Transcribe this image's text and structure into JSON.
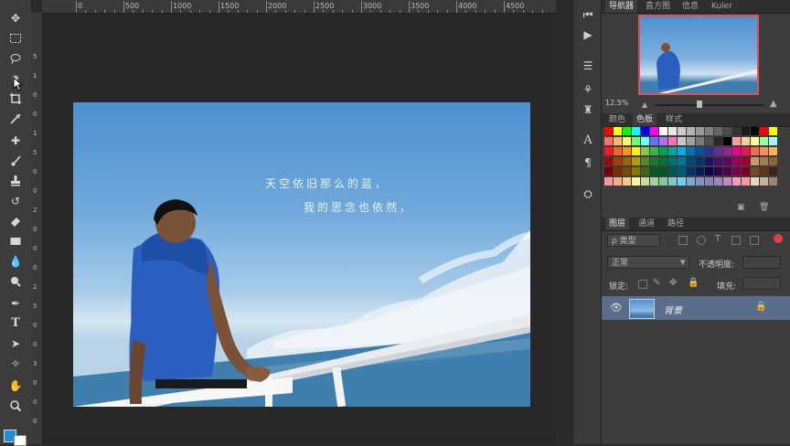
{
  "ruler": {
    "h_ticks": [
      "0",
      "500",
      "1000",
      "1500",
      "2000",
      "2500",
      "3000",
      "3500",
      "4000",
      "4500"
    ],
    "v_ticks": [
      "5",
      "1",
      "0",
      "0",
      "1",
      "5",
      "0",
      "0",
      "2",
      "0",
      "0",
      "0",
      "2",
      "5",
      "0",
      "0",
      "3",
      "0",
      "0",
      "0"
    ]
  },
  "photo": {
    "caption_line1": "天空依旧那么的蓝，",
    "caption_line2": "我的思念也依然，"
  },
  "panels": {
    "navigator": {
      "tabs": [
        "导航器",
        "直方图",
        "信息",
        "Kuler"
      ],
      "zoom": "12.5%"
    },
    "swatches": {
      "tabs": [
        "颜色",
        "色板",
        "样式"
      ]
    },
    "layers": {
      "tabs": [
        "图层",
        "通道",
        "路径"
      ],
      "filter_kind": "ρ 类型",
      "blend_mode": "正常",
      "opacity_label": "不透明度:",
      "lock_label": "锁定:",
      "fill_label": "填充:",
      "layer_name": "背景"
    }
  },
  "colors": {
    "accent_fg": "#1d8fe0",
    "accent_bg": "#ffffff",
    "shirt": "#2a5fc0",
    "sea": "#3e7fae"
  },
  "swatch_colors": [
    [
      "#ff0000",
      "#ffff00",
      "#00ff00",
      "#00ffff",
      "#0000ff",
      "#ff00ff",
      "#ffffff",
      "#e6e6e6",
      "#cccccc",
      "#b3b3b3",
      "#999999",
      "#808080",
      "#666666",
      "#4d4d4d",
      "#333333",
      "#1a1a1a",
      "#000000",
      "#ff0000",
      "#ffff00"
    ],
    [
      "#ff6e6e",
      "#ffb36e",
      "#ffff6e",
      "#6eff6e",
      "#6effff",
      "#6e6eff",
      "#b36eff",
      "#ff6eb3",
      "#c8c8c8",
      "#a0a0a0",
      "#787878",
      "#505050",
      "#282828",
      "#000000",
      "#ff9b9b",
      "#ffcd9b",
      "#ffff9b",
      "#9bff9b",
      "#9bffff"
    ],
    [
      "#ed1c24",
      "#f26522",
      "#f7941d",
      "#fff200",
      "#8dc63f",
      "#39b54a",
      "#00a651",
      "#00a99d",
      "#00aeef",
      "#0072bc",
      "#0054a6",
      "#2e3192",
      "#662d91",
      "#92278f",
      "#ec008c",
      "#ed145b",
      "#f26c4f",
      "#f68e56",
      "#fbaf5d"
    ],
    [
      "#9e0b0f",
      "#a0410d",
      "#a36209",
      "#aba000",
      "#598527",
      "#1a7b30",
      "#007236",
      "#00746b",
      "#0076a3",
      "#004a80",
      "#003471",
      "#1b1464",
      "#440e62",
      "#630460",
      "#9e005d",
      "#9e0039",
      "#c69c6d",
      "#a67c52",
      "#8c6239"
    ],
    [
      "#790000",
      "#7b2e00",
      "#7d4900",
      "#827b00",
      "#406618",
      "#005e20",
      "#005826",
      "#005952",
      "#005b7f",
      "#003663",
      "#002157",
      "#0d004c",
      "#32004b",
      "#4b0049",
      "#7b0046",
      "#7a0026",
      "#754c24",
      "#603913",
      "#3c2415"
    ],
    [
      "#f5989d",
      "#f9ad81",
      "#fdc689",
      "#fff799",
      "#c4df9b",
      "#a3d39c",
      "#82ca9c",
      "#7accc8",
      "#6dcff6",
      "#7da7d9",
      "#8393ca",
      "#8781bd",
      "#a186be",
      "#bd8cbf",
      "#f49ac1",
      "#f6989d",
      "#e6d5b8",
      "#c7b299",
      "#998675"
    ]
  ]
}
